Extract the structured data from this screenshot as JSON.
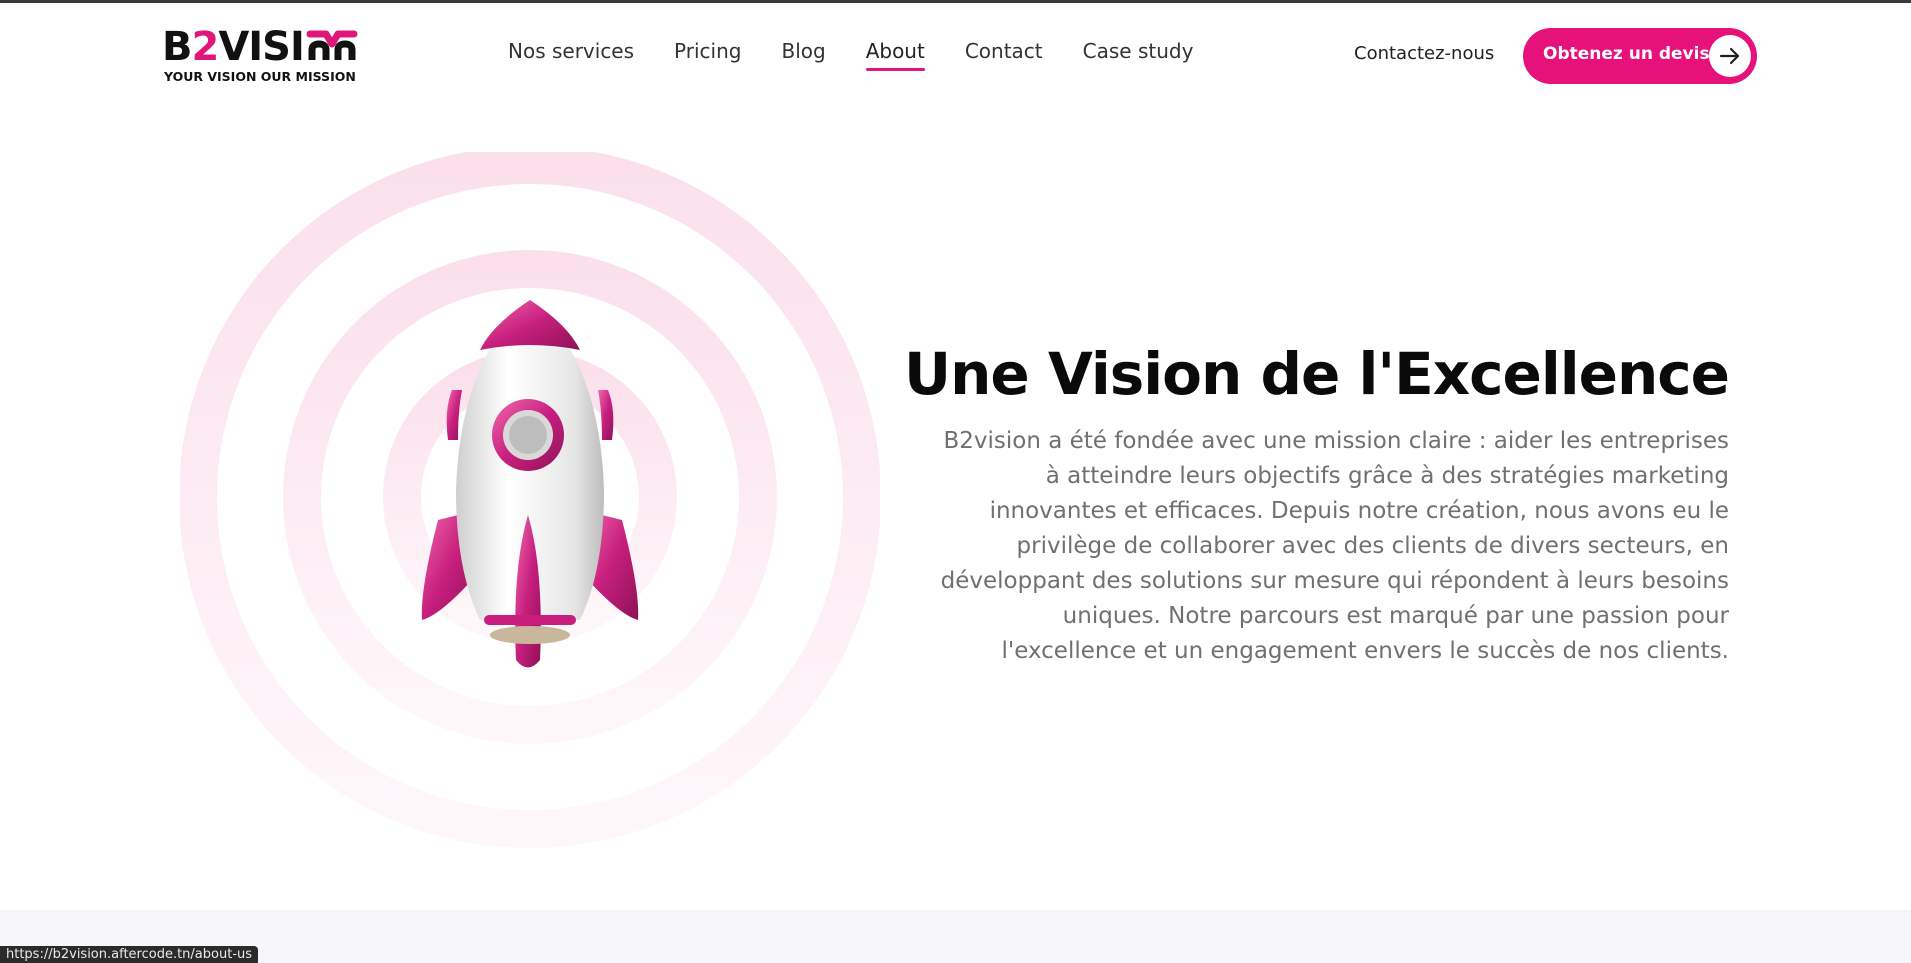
{
  "logo": {
    "word_a": "B",
    "word_accent": "2",
    "word_b": "VISI",
    "tagline": "YOUR VISION OUR MISSION"
  },
  "nav": {
    "items": [
      {
        "label": "Nos services",
        "active": false
      },
      {
        "label": "Pricing",
        "active": false
      },
      {
        "label": "Blog",
        "active": false
      },
      {
        "label": "About",
        "active": true
      },
      {
        "label": "Contact",
        "active": false
      },
      {
        "label": "Case study",
        "active": false
      }
    ]
  },
  "header": {
    "contact_label": "Contactez-nous",
    "cta_label": "Obtenez un devis",
    "cta_icon": "arrow-right-icon"
  },
  "hero": {
    "title": "Une Vision de l'Excellence",
    "text": "B2vision a été fondée avec une mission claire : aider les entreprises à atteindre leurs objectifs grâce à des stratégies marketing innovantes et efficaces. Depuis notre création, nous avons eu le privilège de collaborer avec des clients de divers secteurs, en développant des solutions sur mesure qui répondent à leurs besoins uniques. Notre parcours est marqué par une passion pour l'excellence et un engagement envers le succès de nos clients."
  },
  "status_bar": {
    "url": "https://b2vision.aftercode.tn/about-us"
  },
  "colors": {
    "accent": "#e6117a",
    "ring": "#fbe3ee",
    "text_muted": "#707070"
  }
}
